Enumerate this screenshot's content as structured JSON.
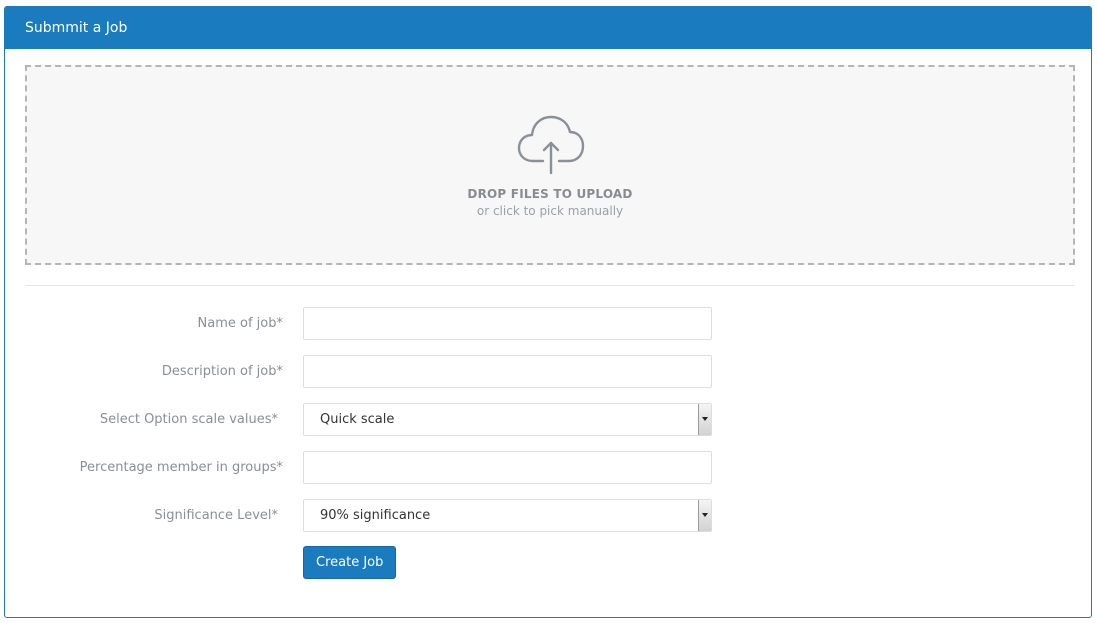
{
  "panel": {
    "title": "Submmit a Job"
  },
  "dropzone": {
    "icon": "cloud-upload-icon",
    "title": "DROP FILES TO UPLOAD",
    "subtitle": "or click to pick manually"
  },
  "form": {
    "name": {
      "label": "Name of job*",
      "value": ""
    },
    "description": {
      "label": "Description of job*",
      "value": ""
    },
    "scale": {
      "label": "Select Option scale values*",
      "selected": "Quick scale"
    },
    "percentage": {
      "label": "Percentage member in groups*",
      "value": ""
    },
    "significance": {
      "label": "Significance Level*",
      "selected": "90% significance"
    },
    "submit_label": "Create Job"
  },
  "colors": {
    "primary": "#1b7bbf",
    "dropzone_bg": "#f7f7f7",
    "label_text": "#8a8f95"
  }
}
